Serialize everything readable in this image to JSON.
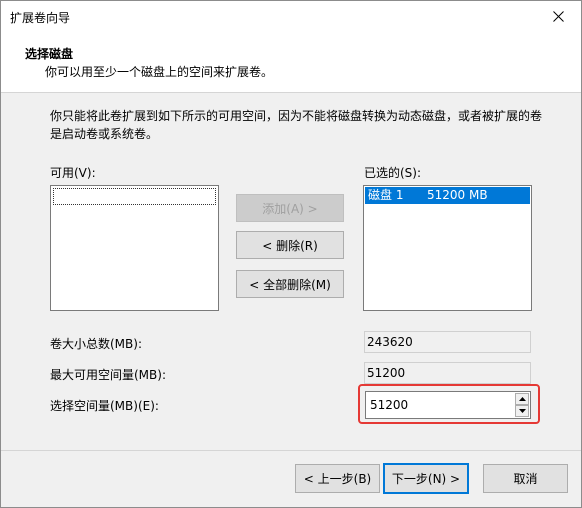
{
  "window": {
    "title": "扩展卷向导"
  },
  "header": {
    "title": "选择磁盘",
    "subtitle": "你可以用至少一个磁盘上的空间来扩展卷。"
  },
  "description": "你只能将此卷扩展到如下所示的可用空间，因为不能将磁盘转换为动态磁盘，或者被扩展的卷是启动卷或系统卷。",
  "available": {
    "label": "可用(V):",
    "items": []
  },
  "selected": {
    "label": "已选的(S):",
    "items": [
      {
        "name": "磁盘 1",
        "size": "51200 MB"
      }
    ]
  },
  "buttons": {
    "add": "添加(A) >",
    "remove": "< 删除(R)",
    "remove_all": "< 全部删除(M)",
    "back": "< 上一步(B)",
    "next": "下一步(N) >",
    "cancel": "取消"
  },
  "fields": {
    "total_label": "卷大小总数(MB):",
    "total_value": "243620",
    "max_label": "最大可用空间量(MB):",
    "max_value": "51200",
    "select_label": "选择空间量(MB)(E):",
    "select_value": "51200"
  },
  "colors": {
    "selection": "#0078d7",
    "highlight_box": "#e53935",
    "default_button_border": "#0078d7"
  }
}
